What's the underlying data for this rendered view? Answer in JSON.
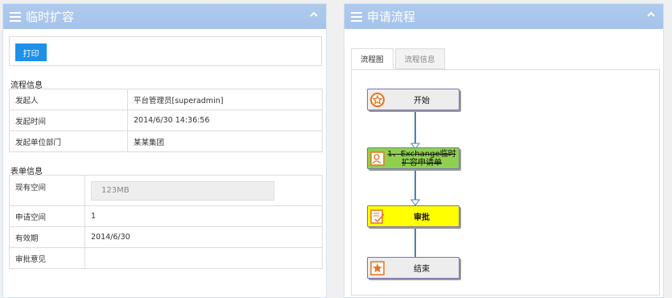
{
  "left_panel": {
    "title": "临时扩容",
    "print_label": "打印",
    "process_section_title": "流程信息",
    "process_rows": [
      {
        "key": "发起人",
        "value": "平台管理员[superadmin]"
      },
      {
        "key": "发起时间",
        "value": "2014/6/30 14:36:56"
      },
      {
        "key": "发起单位部门",
        "value": "某某集团"
      }
    ],
    "form_section_title": "表单信息",
    "form_rows": [
      {
        "key": "现有空间",
        "value": "123MB"
      },
      {
        "key": "申请空间",
        "value": "1"
      },
      {
        "key": "有效期",
        "value": "2014/6/30"
      },
      {
        "key": "审批意见",
        "value": ""
      }
    ]
  },
  "right_panel": {
    "title": "申请流程",
    "tabs": [
      {
        "label": "流程图",
        "active": true
      },
      {
        "label": "流程信息",
        "active": false
      }
    ],
    "flow_nodes": [
      {
        "label": "开始",
        "icon": "start-icon",
        "fill": "#ededed"
      },
      {
        "label": "1、Exchange临时扩容申请单",
        "line1": "1、Exchange临时",
        "line2": "扩容申请单",
        "icon": "user-icon",
        "fill": "#8fd14f",
        "strikethrough": true
      },
      {
        "label": "审批",
        "icon": "approve-icon",
        "fill": "#ffff00",
        "bold": true
      },
      {
        "label": "结束",
        "icon": "end-icon",
        "fill": "#ededed"
      }
    ]
  },
  "colors": {
    "header_bg": "#a8c5ec",
    "print_button": "#1e90e8",
    "connector": "#4a7fbf",
    "node_border": "#7b73b5"
  }
}
